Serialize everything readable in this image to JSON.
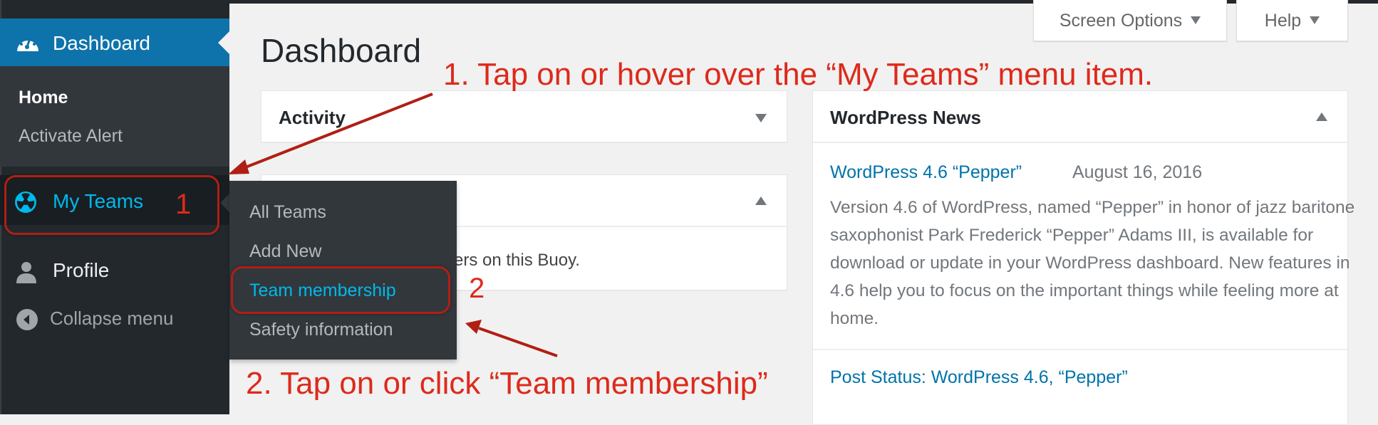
{
  "sidebar": {
    "dashboard_label": "Dashboard",
    "dashboard_icon": "dashboard-gauge-icon",
    "submenu": [
      {
        "label": "Home",
        "current": true
      },
      {
        "label": "Activate Alert",
        "current": false
      }
    ],
    "items": [
      {
        "label": "My Teams",
        "icon": "my-teams-icon",
        "state": "hover"
      },
      {
        "label": "Profile",
        "icon": "user-icon"
      },
      {
        "label": "Collapse menu",
        "icon": "collapse-arrow-icon"
      }
    ]
  },
  "flyout": {
    "items": [
      {
        "label": "All Teams"
      },
      {
        "label": "Add New"
      },
      {
        "label": "Team membership",
        "highlighted": true
      },
      {
        "label": "Safety information"
      }
    ]
  },
  "header": {
    "screen_options_label": "Screen Options",
    "help_label": "Help",
    "page_title": "Dashboard"
  },
  "widgets": {
    "activity": {
      "title": "Activity"
    },
    "second": {
      "title": "",
      "body_text": "ers on this Buoy."
    },
    "news": {
      "title": "WordPress News",
      "items": [
        {
          "link": "WordPress 4.6 “Pepper”",
          "date": "August 16, 2016",
          "excerpt": "Version 4.6 of WordPress, named “Pepper” in honor of jazz baritone saxophonist Park Frederick “Pepper” Adams III, is available for download or update in your WordPress dashboard. New features in 4.6 help you to focus on the important things while feeling more at home."
        },
        {
          "link": "Post Status: WordPress 4.6, “Pepper”"
        }
      ]
    }
  },
  "annotations": {
    "step1": "1. Tap on or hover over the “My Teams” menu item.",
    "step2": "2. Tap on or click “Team membership”",
    "marker1": "1",
    "marker2": "2",
    "color": "#dd2a1b"
  },
  "colors": {
    "sidebar_bg": "#23282d",
    "accent_blue": "#0e73aa",
    "hover_cyan": "#00b9eb",
    "link_blue": "#0073aa"
  }
}
